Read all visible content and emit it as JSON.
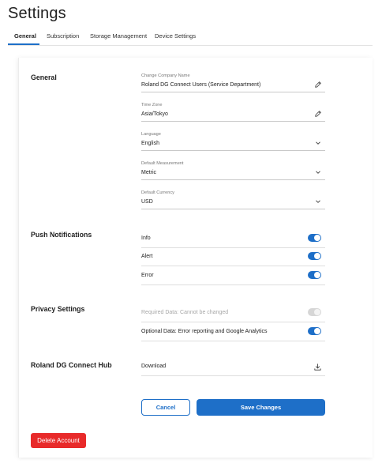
{
  "page": {
    "title": "Settings"
  },
  "tabs": [
    {
      "label": "General",
      "active": true
    },
    {
      "label": "Subscription"
    },
    {
      "label": "Storage Management"
    },
    {
      "label": "Device Settings"
    }
  ],
  "general": {
    "title": "General",
    "company": {
      "label": "Change Company Name",
      "value": "Roland DG Connect Users (Service Department)",
      "icon": "pencil-icon"
    },
    "timezone": {
      "label": "Time Zone",
      "value": "Asia/Tokyo",
      "icon": "pencil-icon"
    },
    "language": {
      "label": "Language",
      "value": "English",
      "icon": "chevron-down-icon"
    },
    "measurement": {
      "label": "Default Measurement",
      "value": "Metric",
      "icon": "chevron-down-icon"
    },
    "currency": {
      "label": "Default Currency",
      "value": "USD",
      "icon": "chevron-down-icon"
    }
  },
  "push": {
    "title": "Push Notifications",
    "items": [
      {
        "label": "Info",
        "on": true
      },
      {
        "label": "Alert",
        "on": true
      },
      {
        "label": "Error",
        "on": true
      }
    ]
  },
  "privacy": {
    "title": "Privacy Settings",
    "required": {
      "label": "Required Data:  Cannot be changed",
      "on": true,
      "disabled": true
    },
    "optional": {
      "label": "Optional Data:  Error reporting and Google Analytics",
      "on": true
    }
  },
  "hub": {
    "title": "Roland DG Connect Hub",
    "download": {
      "label": "Download",
      "icon": "download-icon"
    }
  },
  "actions": {
    "cancel": "Cancel",
    "save": "Save Changes",
    "delete": "Delete Account"
  },
  "colors": {
    "accent": "#1e6fc8",
    "danger": "#e82a2a",
    "toggle_disabled": "#d6d6d6"
  }
}
